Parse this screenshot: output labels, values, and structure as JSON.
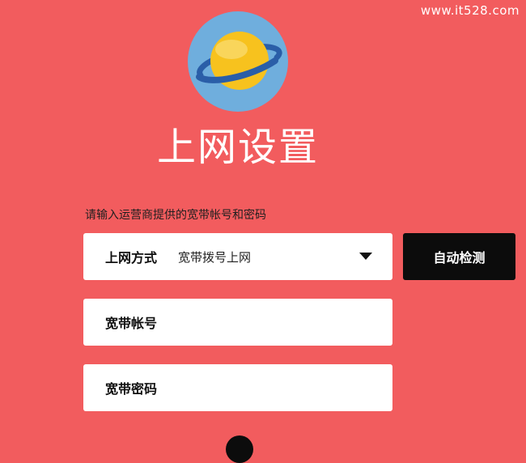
{
  "watermark": "www.it528.com",
  "page_title": "上网设置",
  "hint": "请输入运营商提供的宽带帐号和密码",
  "connection": {
    "label": "上网方式",
    "value": "宽带拨号上网",
    "detect_label": "自动检测"
  },
  "account": {
    "label": "宽带帐号",
    "value": ""
  },
  "password": {
    "label": "宽带密码",
    "value": ""
  },
  "colors": {
    "background": "#f25c5e",
    "button": "#0c0c0c",
    "logo_circle": "#6faedd",
    "planet": "#f7c21e",
    "ring": "#2a5ea8"
  },
  "icons": {
    "logo": "planet-icon",
    "dropdown": "caret-down-icon"
  }
}
